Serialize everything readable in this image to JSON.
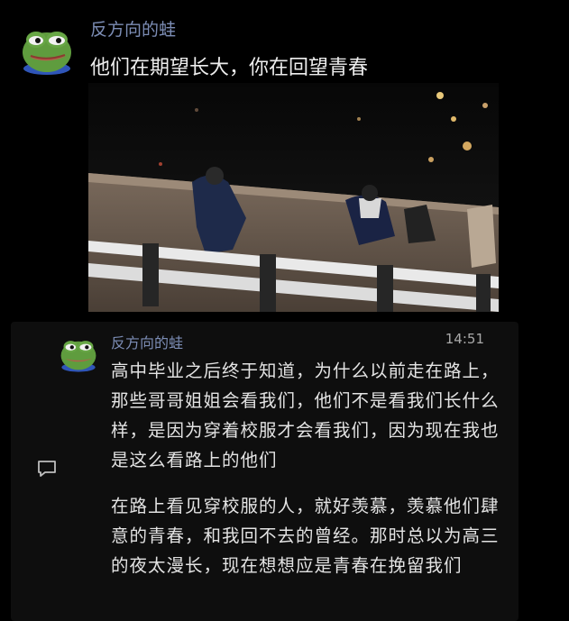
{
  "post": {
    "author": "反方向的蛙",
    "text": "他们在期望长大，你在回望青春"
  },
  "quote": {
    "author": "反方向的蛙",
    "time": "14:51",
    "paragraph1": "高中毕业之后终于知道，为什么以前走在路上，那些哥哥姐姐会看我们，他们不是看我们长什么样，是因为穿着校服才会看我们，因为现在我也是这么看路上的他们",
    "paragraph2": "在路上看见穿校服的人，就好羡慕，羡慕他们肆意的青春，和我回不去的曾经。那时总以为高三的夜太漫长，现在想想应是青春在挽留我们"
  },
  "icons": {
    "avatar": "frog-avatar-icon",
    "comment": "comment-icon"
  }
}
